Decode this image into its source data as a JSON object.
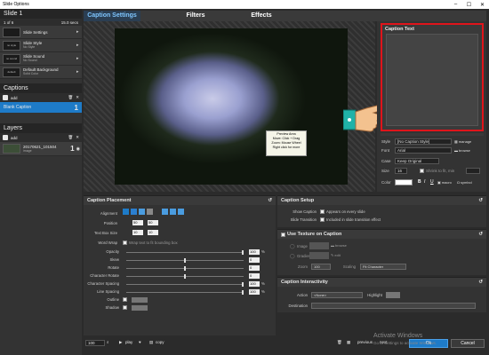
{
  "window": {
    "title": "Slide Options"
  },
  "left": {
    "slide_header": "Slide 1",
    "slide_counter": "1 of 6",
    "slide_duration": "15.0 secs",
    "rows": [
      {
        "thumb": "",
        "title": "Slide Settings",
        "sub": ""
      },
      {
        "thumb": "no style",
        "title": "Slide Style",
        "sub": "No Style"
      },
      {
        "thumb": "no sound",
        "title": "Slide Sound",
        "sub": "No Sound"
      },
      {
        "thumb": "default",
        "title": "Default Background",
        "sub": "Solid Color"
      }
    ],
    "captions_header": "Captions",
    "captions_add": "add",
    "caption_item": "Blank Caption",
    "caption_num": "1",
    "layers_header": "Layers",
    "layers_add": "add",
    "layer_title": "20170621_101504",
    "layer_sub": "image",
    "layer_num": "1"
  },
  "tabs": [
    "Caption Settings",
    "Filters",
    "Effects"
  ],
  "tooltip": [
    "Preview Area",
    "Move: Click + Drag",
    "Zoom: Mouse Wheel",
    "Right click for more"
  ],
  "caption_text": {
    "label": "Caption Text"
  },
  "caption_format": {
    "style_label": "Style",
    "style_value": "[No Caption Style]",
    "style_btn": "manage",
    "font_label": "Font",
    "font_value": "Arial",
    "font_btn": "browse",
    "case_label": "Case",
    "case_value": "Keep Original",
    "size_label": "Size",
    "size_value": "16",
    "size_hint": "Shrink to fit, min",
    "color_label": "Color",
    "macro": "macro",
    "symbol": "symbol"
  },
  "placement": {
    "title": "Caption Placement",
    "alignment": "Alignment",
    "position": "Position",
    "pos_x": "50",
    "pos_y": "50",
    "textbox": "Text Box Size",
    "tb_w": "10",
    "tb_h": "10",
    "wordwrap": "Word Wrap",
    "wordwrap_hint": "Wrap text to fit bounding box",
    "labels": [
      "Opacity",
      "Skew",
      "Rotate",
      "Character Rotate",
      "Character Spacing",
      "Line Spacing",
      "Outline",
      "Shadow"
    ],
    "values": [
      "100",
      "0",
      "0",
      "0",
      "100",
      "100",
      "",
      ""
    ],
    "suffix": [
      "%",
      "",
      "",
      "",
      "%",
      "%",
      "",
      ""
    ]
  },
  "setup": {
    "title": "Caption Setup",
    "show_caption": "Show Caption",
    "show_caption_opt": "Appears on every slide",
    "slide_transition": "Slide Transition",
    "slide_transition_opt": "Included in slide transition effect"
  },
  "texture": {
    "title": "Use Texture on Caption",
    "image": "Image",
    "browse": "browse",
    "gradient": "Gradient",
    "edit": "edit",
    "zoom": "Zoom",
    "zoom_value": "100",
    "scaling": "Scaling",
    "scaling_value": "Fit Character"
  },
  "interactivity": {
    "title": "Caption Interactivity",
    "action": "Action",
    "action_value": "<None>",
    "highlight": "Highlight",
    "destination": "Destination"
  },
  "bottom": {
    "zoom": "100",
    "play": "play",
    "copy": "copy",
    "previous": "previous",
    "next": "next",
    "ok": "Ok",
    "cancel": "Cancel"
  },
  "watermark": {
    "line1": "Activate Windows",
    "line2": "Go to Settings to activate Windows."
  },
  "colors": {
    "accent": "#1e7bc8",
    "highlight_box": "#e0141b",
    "tab_active": "#7fc6ff"
  }
}
